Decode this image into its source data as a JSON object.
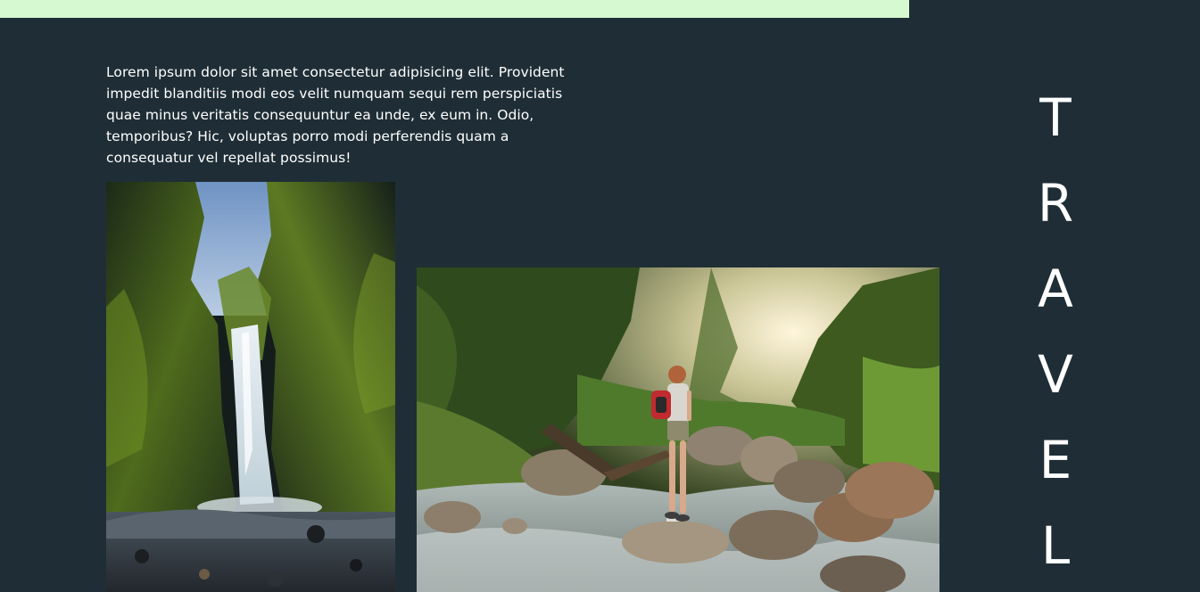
{
  "colors": {
    "background": "#1f2e36",
    "top_band": "#d7f9d1",
    "text": "#ffffff"
  },
  "intro": {
    "text": "Lorem ipsum dolor sit amet consectetur adipisicing elit. Provident impedit blanditiis modi eos velit numquam sequi rem perspiciatis quae minus veritatis consequuntur ea unde, ex eum in. Odio, temporibus? Hic, voluptas porro modi perferendis quam a consequatur vel repellat possimus!"
  },
  "side_word": {
    "letters": [
      "T",
      "R",
      "A",
      "V",
      "E",
      "L"
    ]
  }
}
